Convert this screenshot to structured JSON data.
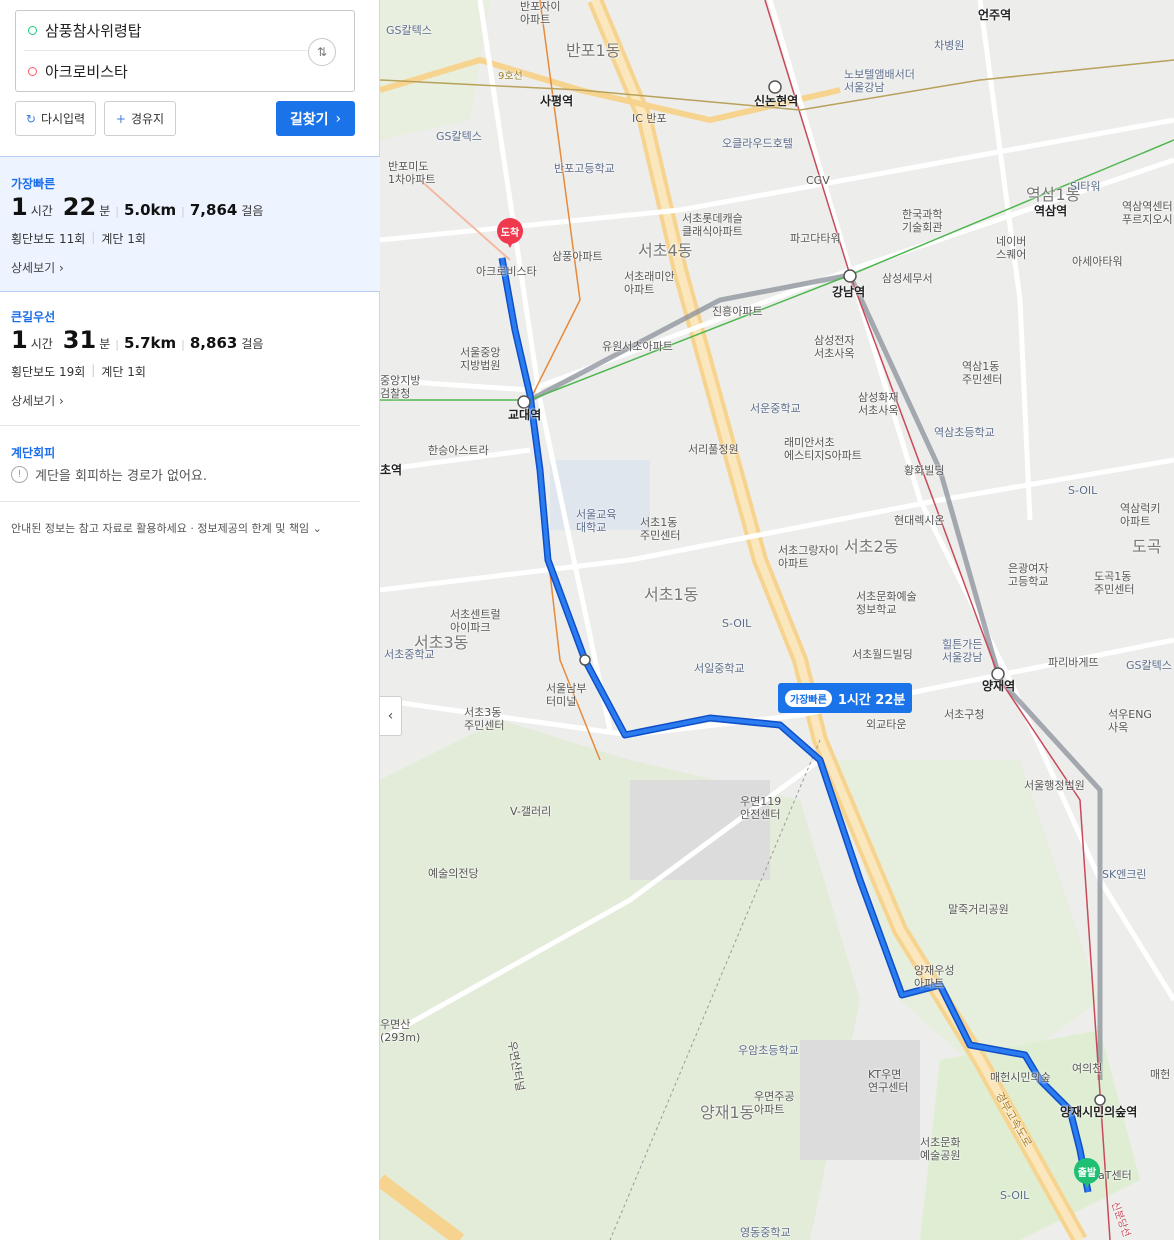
{
  "search": {
    "start_place": "삼풍참사위령탑",
    "end_place": "아크로비스타",
    "swap_icon": "swap-vertical-icon",
    "reset_label": "다시입력",
    "waypoint_label": "경유지",
    "go_label": "길찾기"
  },
  "routes": [
    {
      "label": "가장빠른",
      "hours": "1",
      "hours_unit": "시간",
      "minutes": "22",
      "minutes_unit": "분",
      "distance": "5.0km",
      "steps": "7,864",
      "steps_unit": "걸음",
      "crosswalks": "횡단보도 11회",
      "stairs": "계단 1회",
      "more": "상세보기"
    },
    {
      "label": "큰길우선",
      "hours": "1",
      "hours_unit": "시간",
      "minutes": "31",
      "minutes_unit": "분",
      "distance": "5.7km",
      "steps": "8,863",
      "steps_unit": "걸음",
      "crosswalks": "횡단보도 19회",
      "stairs": "계단 1회",
      "more": "상세보기"
    }
  ],
  "stair_avoid": {
    "label": "계단회피",
    "message": "계단을 회피하는 경로가 없어요."
  },
  "notice": "안내된 정보는 참고 자료로 활용하세요 · 정보제공의 한계 및 책임",
  "map": {
    "route_tag_pill": "가장빠른",
    "route_tag_time": "1시간 22분",
    "start_pin": "출발",
    "end_pin": "도착",
    "route_color": "#1a73e8",
    "labels": {
      "banpo_jai": "반포자이\n아파트",
      "banpo1": "반포1동",
      "eonju": "언주역",
      "gs1": "GS칼텍스",
      "chaum": "차병원",
      "novotel": "노보텔앰배서더\n서울강남",
      "sinnonhyeon": "신논현역",
      "sapyeong": "사평역",
      "banpo_ic": "IC 반포",
      "okwood": "오클라우드호텔",
      "gs2": "GS칼텍스",
      "banpo_high": "반포고등학교",
      "banpomido": "반포미도\n1차아파트",
      "cgv": "CGV",
      "lotte": "서초롯데캐슬\n클래식아파트",
      "kofst": "한국과학\n기술회관",
      "yeoksam1": "역삼1동",
      "yeoksam_stn": "역삼역",
      "sil": "SI타워",
      "samsung_st": "삼풍아파트",
      "seocho4": "서초4동",
      "paris": "파고다타워",
      "naver": "네이버\n스퀘어",
      "yeoksam_st2": "역삼역센터\n푸르지오시",
      "acro": "아크로비스타",
      "raemian": "서초래미안\n아파트",
      "gangnam": "강남역",
      "samsung_tax": "삼성세무서",
      "ase": "아세아타워",
      "jinheung": "진흥아파트",
      "yuwon": "유원서초아파트",
      "samsung_el": "삼성전자\n서초사옥",
      "court": "서울중앙\n지방법원",
      "prosecutor": "중앙지방\n검찰청",
      "yeoksam1dong": "역삼1동\n주민센터",
      "gyodae": "교대역",
      "seoun": "서운중학교",
      "samsung_fire": "삼성화재\n서초사옥",
      "yeoksam_el": "역삼초등학교",
      "hansung": "한승아스트라",
      "seori": "서리풀정원",
      "raemian_est": "래미안서초\n에스티지S아파트",
      "hwang": "황화빌딩",
      "soil1": "S-OIL",
      "yeoksam_lucky": "역삼럭키\n아파트",
      "seocho_stn": "초역",
      "edu_univ": "서울교육\n대학교",
      "seocho1_center": "서초1동\n주민센터",
      "hyundai": "현대렉시온",
      "seocho2": "서초2동",
      "grandi": "서초그랑자이\n아파트",
      "eunkwang": "은광여자\n고등학교",
      "dogok": "도곡",
      "dogok1": "도곡1동\n주민센터",
      "centreville": "서초센트럴\n아이파크",
      "seocho1": "서초1동",
      "culture": "서초문화예술\n정보학교",
      "soil2": "S-OIL",
      "seocho3": "서초3동",
      "seocho_mid": "서초중학교",
      "terminal": "서울남부\n터미널",
      "seoil": "서일중학교",
      "world": "서초월드빌딩",
      "hillstate": "힐튼가든\n서울강남",
      "paris2": "파리바게뜨",
      "gs3": "GS칼텍스",
      "yangjae_stn": "양재역",
      "seocho3_center": "서초3동\n주민센터",
      "outer": "외교타운",
      "seocho_gu": "서초구청",
      "seokwoo": "석우ENG\n사옥",
      "vgallery": "V-갤러리",
      "safety": "우면119\n안전센터",
      "admin_court": "서울행정법원",
      "arts": "예술의전당",
      "sk": "SK엔크린",
      "malgeori": "말죽거리공원",
      "yangjae_apt": "양재우성\n아파트",
      "umyeon_mt": "우면산\n(293m)",
      "umam": "우암초등학교",
      "kt": "KT우면\n연구센터",
      "maeheon": "매헌시민의숲",
      "yangjae_forest": "양재시민의숲역",
      "yeouijeon": "여의천",
      "maehe": "매헌",
      "umyeon_apt": "우면주공\n아파트",
      "yangjae1": "양재1동",
      "culture_park": "서초문화\n예술공원",
      "at_center": "aT센터",
      "soil3": "S-OIL",
      "yeongdong": "영동중학교",
      "umyeon_rd": "우면산터널",
      "gyeongbu": "경부고속도로",
      "hwy_9": "9호선",
      "sillim_rd": "신분당선"
    }
  }
}
